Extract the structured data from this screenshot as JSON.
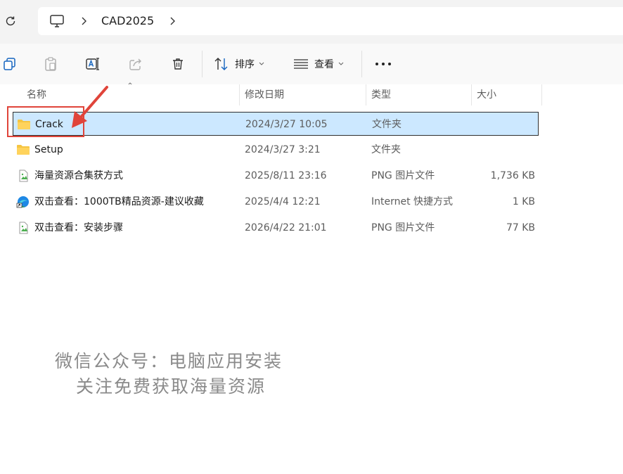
{
  "address_bar": {
    "refresh_icon": "refresh-icon",
    "location_icon": "computer-icon",
    "breadcrumb": [
      "CAD2025"
    ]
  },
  "toolbar": {
    "copy_icon": "copy-icon",
    "paste_icon": "paste-icon",
    "rename_icon": "rename-icon",
    "share_icon": "share-icon",
    "delete_icon": "trash-icon",
    "sort_label": "排序",
    "view_label": "查看",
    "more_label": "···"
  },
  "columns": {
    "name": "名称",
    "modified": "修改日期",
    "type": "类型",
    "size": "大小"
  },
  "files": [
    {
      "name": "Crack",
      "modified": "2024/3/27 10:05",
      "type": "文件夹",
      "size": "",
      "icon": "folder-icon",
      "selected": true
    },
    {
      "name": "Setup",
      "modified": "2024/3/27 3:21",
      "type": "文件夹",
      "size": "",
      "icon": "folder-icon",
      "selected": false
    },
    {
      "name": "海量资源合集获方式",
      "modified": "2025/8/11 23:16",
      "type": "PNG 图片文件",
      "size": "1,736 KB",
      "icon": "image-file-icon",
      "selected": false
    },
    {
      "name": "双击查看：1000TB精品资源-建议收藏",
      "modified": "2025/4/4 12:21",
      "type": "Internet 快捷方式",
      "size": "1 KB",
      "icon": "internet-shortcut-icon",
      "selected": false
    },
    {
      "name": "双击查看：安装步骤",
      "modified": "2026/4/22 21:01",
      "type": "PNG 图片文件",
      "size": "77 KB",
      "icon": "image-file-icon",
      "selected": false
    }
  ],
  "watermark": {
    "line1": "微信公众号：电脑应用安装",
    "line2": "关注免费获取海量资源"
  },
  "colors": {
    "selection": "#cce8ff",
    "annotation": "#e0443a",
    "folder": "#f5c542"
  }
}
